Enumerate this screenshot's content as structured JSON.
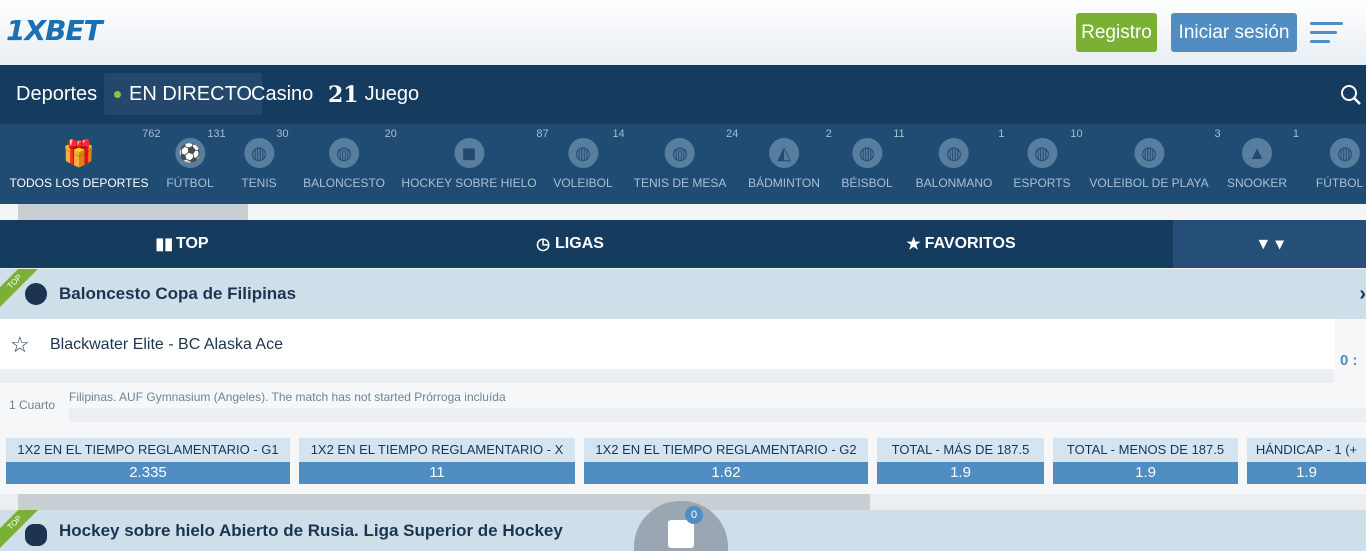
{
  "header": {
    "logo": "1XBET",
    "register_label": "Registro",
    "login_label": "Iniciar sesión"
  },
  "nav": {
    "deportes": "Deportes",
    "en_directo": "EN DIRECTO",
    "casino": "Casino",
    "juego_num": "21",
    "juego": "Juego"
  },
  "sports": [
    {
      "label": "TODOS LOS DEPORTES",
      "count": "762"
    },
    {
      "label": "FÚTBOL",
      "count": "131"
    },
    {
      "label": "TENIS",
      "count": "30"
    },
    {
      "label": "BALONCESTO",
      "count": "20"
    },
    {
      "label": "HOCKEY SOBRE HIELO",
      "count": "87"
    },
    {
      "label": "VOLEIBOL",
      "count": "14"
    },
    {
      "label": "TENIS DE MESA",
      "count": "24"
    },
    {
      "label": "BÁDMINTON",
      "count": "2"
    },
    {
      "label": "BÉISBOL",
      "count": "11"
    },
    {
      "label": "BALONMANO",
      "count": "1"
    },
    {
      "label": "ESPORTS",
      "count": "10"
    },
    {
      "label": "VOLEIBOL DE PLAYA",
      "count": "3"
    },
    {
      "label": "SNOOKER",
      "count": "1"
    },
    {
      "label": "FÚTBOL S",
      "count": ""
    }
  ],
  "tabs": {
    "top": "TOP",
    "ligas": "LIGAS",
    "favoritos": "FAVORITOS"
  },
  "league1": {
    "ribbon": "TOP",
    "name": "Baloncesto Copa de Filipinas"
  },
  "match": {
    "teams": "Blackwater Elite - BC Alaska Ace",
    "score": "0 :",
    "period": "1 Cuarto",
    "info": "Filipinas. AUF Gymnasium (Angeles). The match has not started Prórroga incluída",
    "odds": [
      {
        "label": "1X2 EN EL TIEMPO REGLAMENTARIO - G1",
        "value": "2.335"
      },
      {
        "label": "1X2 EN EL TIEMPO REGLAMENTARIO - X",
        "value": "11"
      },
      {
        "label": "1X2 EN EL TIEMPO REGLAMENTARIO - G2",
        "value": "1.62"
      },
      {
        "label": "TOTAL - MÁS DE 187.5",
        "value": "1.9"
      },
      {
        "label": "TOTAL - MENOS DE 187.5",
        "value": "1.9"
      },
      {
        "label": "HÁNDICAP - 1 (+",
        "value": "1.9"
      }
    ]
  },
  "league2": {
    "ribbon": "TOP",
    "name": "Hockey sobre hielo Abierto de Rusia. Liga Superior de Hockey"
  },
  "coupon": {
    "count": "0"
  }
}
